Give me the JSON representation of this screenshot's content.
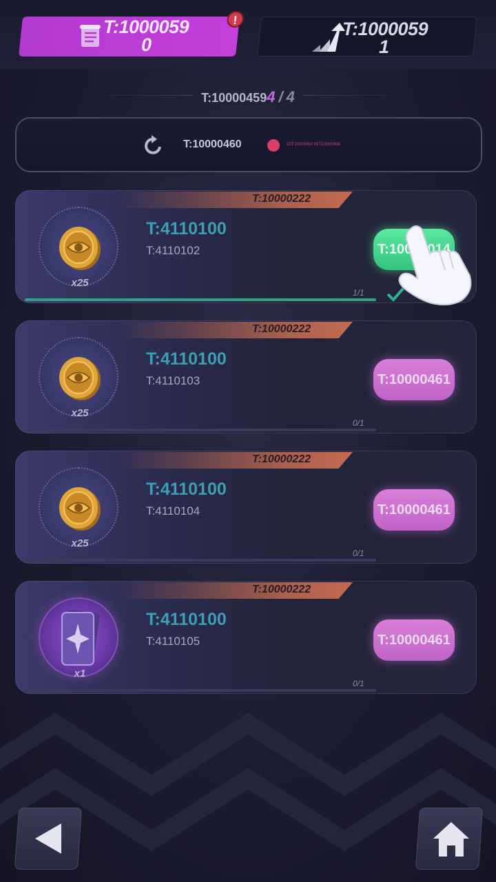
{
  "tabs": {
    "left": {
      "label": "T:1000059",
      "count": "0",
      "has_alert": true,
      "alert": "!"
    },
    "right": {
      "label": "T:1000059",
      "count": "1"
    }
  },
  "progress": {
    "label": "T:10000459",
    "current": "4",
    "separator": "/",
    "total": "4"
  },
  "refresh": {
    "label": "T:10000460",
    "timer_text": "10T:10000454 09T:10000458"
  },
  "tasks": [
    {
      "tag": "T:10000222",
      "title": "T:4110100",
      "desc": "T:4110102",
      "reward_count": "x25",
      "reward_icon": "coin-icon",
      "button": "T:10000014",
      "button_state": "claim",
      "progress": "1/1",
      "progress_fraction": 1.0,
      "completed": true
    },
    {
      "tag": "T:10000222",
      "title": "T:4110100",
      "desc": "T:4110103",
      "reward_count": "x25",
      "reward_icon": "coin-icon",
      "button": "T:10000461",
      "button_state": "go",
      "progress": "0/1",
      "progress_fraction": 0.0,
      "completed": false
    },
    {
      "tag": "T:10000222",
      "title": "T:4110100",
      "desc": "T:4110104",
      "reward_count": "x25",
      "reward_icon": "coin-icon",
      "button": "T:10000461",
      "button_state": "go",
      "progress": "0/1",
      "progress_fraction": 0.0,
      "completed": false
    },
    {
      "tag": "T:10000222",
      "title": "T:4110100",
      "desc": "T:4110105",
      "reward_count": "x1",
      "reward_icon": "card-icon",
      "button": "T:10000461",
      "button_state": "go",
      "progress": "0/1",
      "progress_fraction": 0.0,
      "completed": false
    }
  ],
  "nav": {
    "back_icon": "back-arrow-icon",
    "home_icon": "home-icon"
  },
  "colors": {
    "accent_pink": "#c063c8",
    "accent_green": "#33c47e",
    "title_teal": "#3c9fb3",
    "tab_active": "#c43edb"
  }
}
